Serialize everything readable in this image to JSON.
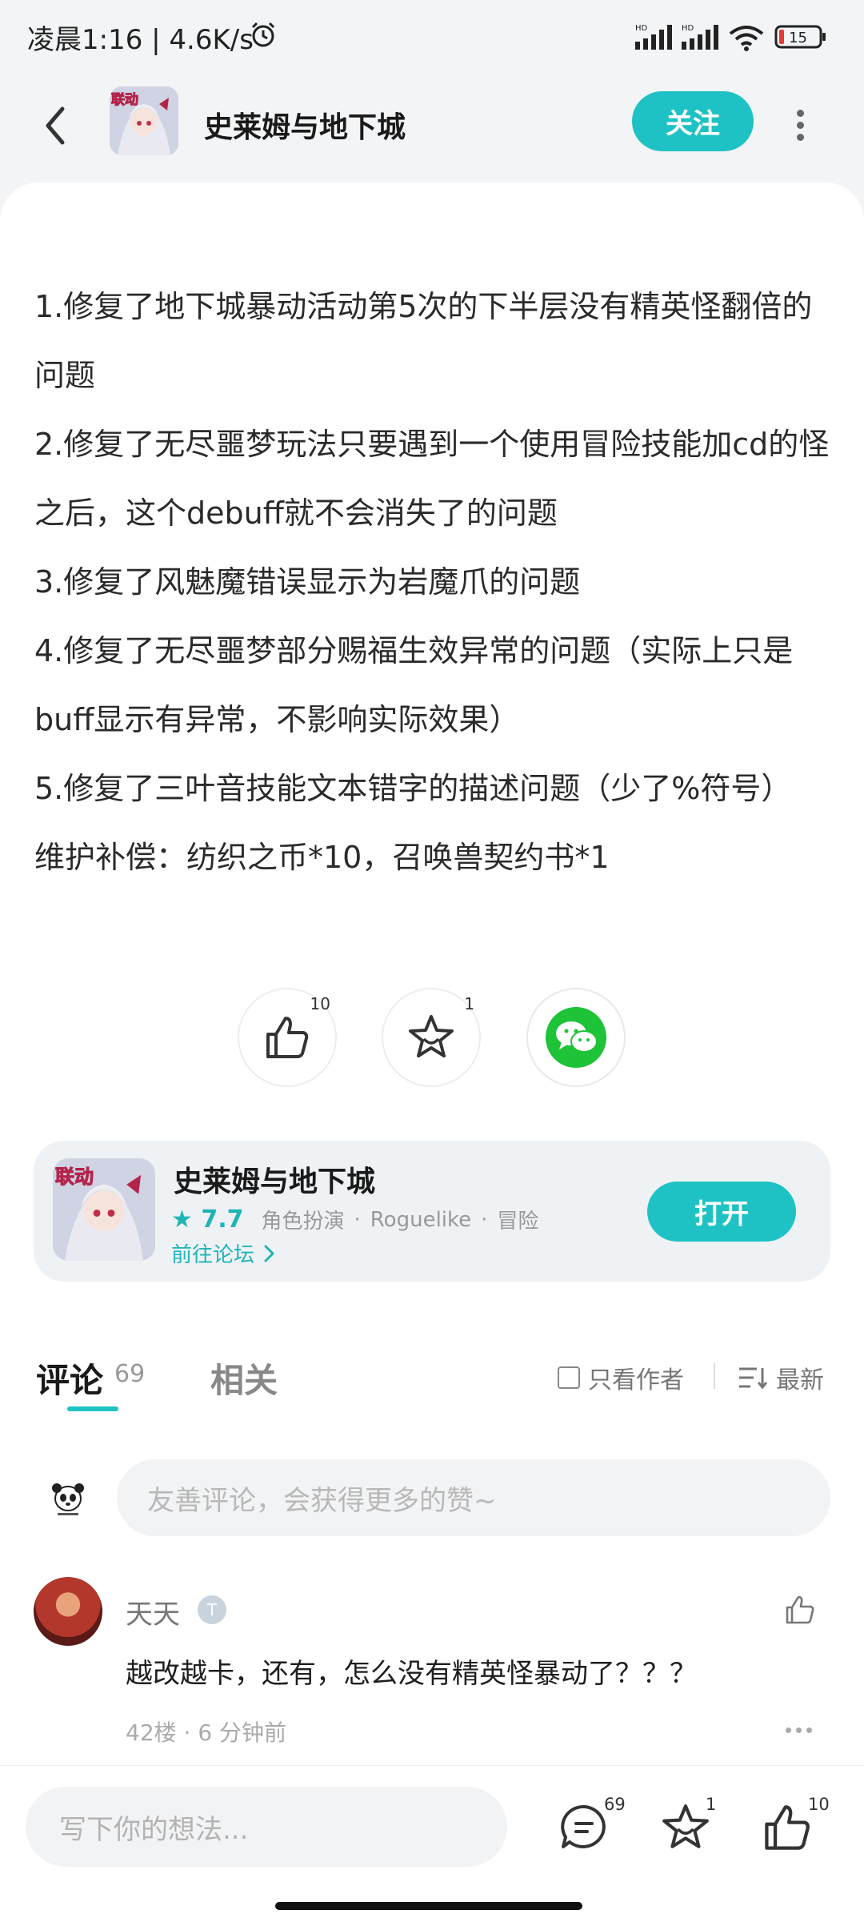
{
  "status_bar": {
    "time_speed": "凌晨1:16 | 4.6K/s",
    "signal1_label": "HD",
    "signal2_label": "HD",
    "battery": "15"
  },
  "header": {
    "title": "史莱姆与地下城",
    "follow_label": "关注",
    "icon_badge": "联动"
  },
  "article": {
    "paragraphs": [
      "1.修复了地下城暴动活动第5次的下半层没有精英怪翻倍的问题",
      "2.修复了无尽噩梦玩法只要遇到一个使用冒险技能加cd的怪之后，这个debuff就不会消失了的问题",
      "3.修复了风魅魔错误显示为岩魔爪的问题",
      "4.修复了无尽噩梦部分赐福生效异常的问题（实际上只是buff显示有异常，不影响实际效果）",
      "5.修复了三叶音技能文本错字的描述问题（少了%符号）",
      "维护补偿：纺织之币*10，召唤兽契约书*1"
    ]
  },
  "actions": {
    "like_count": "10",
    "favorite_count": "1"
  },
  "game_card": {
    "title": "史莱姆与地下城",
    "score": "7.7",
    "tags": [
      "角色扮演",
      "Roguelike",
      "冒险"
    ],
    "forum_link": "前往论坛",
    "open_label": "打开",
    "icon_badge": "联动"
  },
  "comments": {
    "tab_comments": "评论",
    "comment_count": "69",
    "tab_related": "相关",
    "only_author": "只看作者",
    "sort_label": "最新",
    "input_placeholder": "友善评论，会获得更多的赞~",
    "items": [
      {
        "user": "天天",
        "badge": "T",
        "text": "越改越卡，还有，怎么没有精英怪暴动了？？？",
        "meta": "42楼 · 6 分钟前"
      }
    ]
  },
  "bottom_bar": {
    "write_placeholder": "写下你的想法...",
    "comment_count": "69",
    "favorite_count": "1",
    "like_count": "10"
  },
  "colors": {
    "accent": "#1fc2c4",
    "wechat": "#1ec338",
    "battery_low": "#e53935"
  }
}
